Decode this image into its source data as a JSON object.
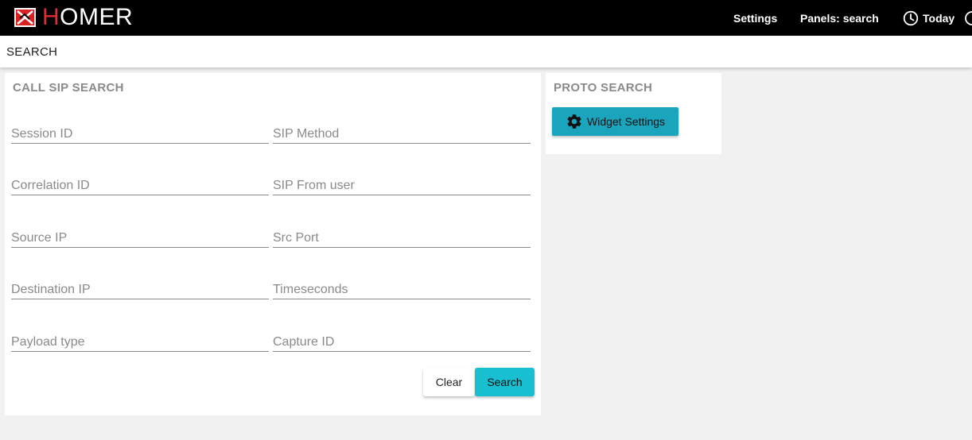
{
  "header": {
    "brand_first": "H",
    "brand_rest": "OMER",
    "nav": {
      "settings": "Settings",
      "panels": "Panels: search",
      "today": "Today"
    }
  },
  "subheader": {
    "title": "SEARCH"
  },
  "sip_panel": {
    "title": "CALL SIP SEARCH",
    "fields": {
      "session_id": "Session ID",
      "sip_method": "SIP Method",
      "correlation_id": "Correlation ID",
      "sip_from_user": "SIP From user",
      "source_ip": "Source IP",
      "src_port": "Src Port",
      "destination_ip": "Destination IP",
      "timeseconds": "Timeseconds",
      "payload_type": "Payload type",
      "capture_id": "Capture ID"
    },
    "buttons": {
      "clear": "Clear",
      "search": "Search"
    }
  },
  "proto_panel": {
    "title": "PROTO SEARCH",
    "widget_settings": "Widget Settings"
  },
  "colors": {
    "topbar": "#000000",
    "brand_accent": "#e32d2d",
    "search_button": "#17bfd0",
    "widget_button": "#1aa5bd"
  },
  "icons": {
    "logo": "homer-logo-icon",
    "today": "clock-icon",
    "widget": "gear-icon"
  }
}
